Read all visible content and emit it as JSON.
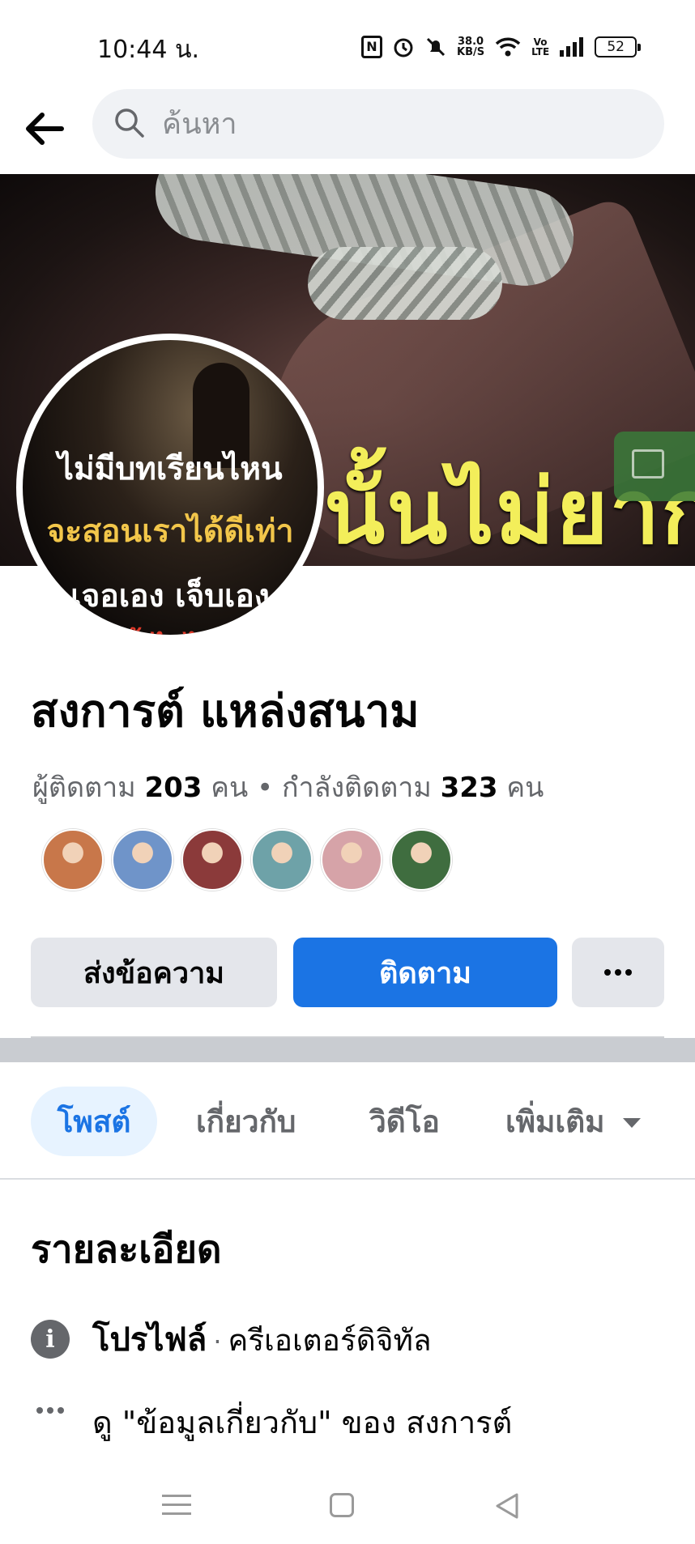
{
  "status_bar": {
    "time": "10:44 น.",
    "nfc_icon": "N",
    "net_speed_top": "38.0",
    "net_speed_unit": "KB/S",
    "volte_top": "Vo",
    "volte_bottom": "LTE",
    "battery": "52"
  },
  "search": {
    "placeholder": "ค้นหา"
  },
  "cover": {
    "overlay_text": "นั้นไม่ยาก"
  },
  "avatar": {
    "line1": "ไม่มีบทเรียนไหน",
    "line2": "จะสอนเราได้ดีเท่า",
    "line3": "เจอเอง เจ็บเอง",
    "line4": "ยั้งไม่ได้"
  },
  "profile": {
    "name": "สงการต์ แหล่งสนาม",
    "followers_label": "ผู้ติดตาม ",
    "followers_count": "203",
    "followers_unit": " คน",
    "separator": " • ",
    "following_label": "กำลังติดตาม ",
    "following_count": "323",
    "following_unit": " คน"
  },
  "friends": {
    "colors": [
      "#c8774a",
      "#6f94c9",
      "#8b3a3a",
      "#6ea2a8",
      "#d6a3a8",
      "#3f6d3f"
    ]
  },
  "actions": {
    "message_label": "ส่งข้อความ",
    "follow_label": "ติดตาม"
  },
  "tabs": {
    "posts": "โพสต์",
    "about": "เกี่ยวกับ",
    "videos": "วิดีโอ",
    "more": "เพิ่มเติม"
  },
  "details": {
    "title": "รายละเอียด",
    "profile_label": "โปรไฟล์",
    "dot": "·",
    "profile_category": "ครีเอเตอร์ดิจิทัล",
    "about_link": "ดู \"ข้อมูลเกี่ยวกับ\" ของ สงการต์"
  },
  "theme": {
    "accent": "#1b74e4",
    "tab_active_bg": "#e7f3ff",
    "secondary_button": "#e4e6eb",
    "muted_text": "#65676b"
  }
}
